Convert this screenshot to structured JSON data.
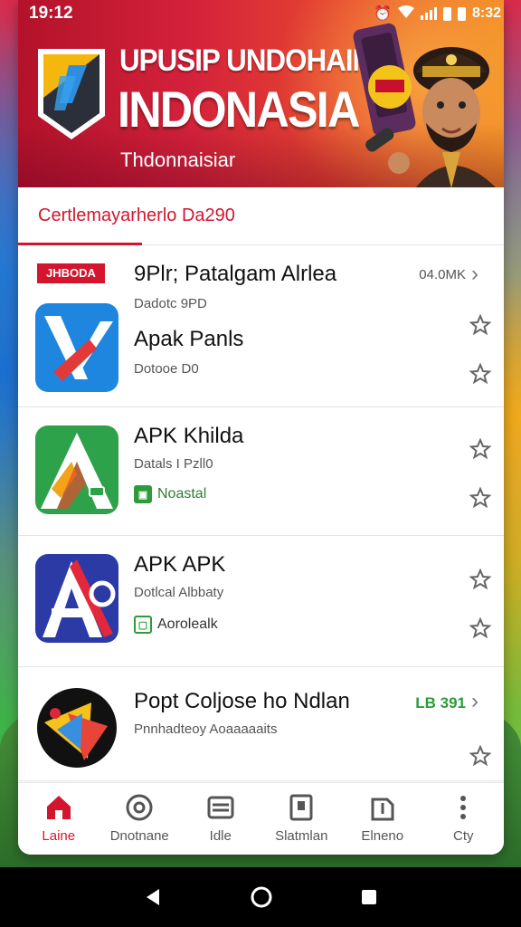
{
  "status_bar": {
    "time": "19:12",
    "clock_right": "8:32",
    "icons": [
      "alarm-icon",
      "wifi-icon",
      "signal-icon",
      "battery-icon"
    ]
  },
  "banner": {
    "title_line1": "UPUSIP UNDOHAIN",
    "title_line2": "INDONASIA",
    "subtitle": "Thdonnaisiar"
  },
  "section": {
    "title": "Certlemayarherlo Da290"
  },
  "apps": [
    {
      "tag": "JHBODA",
      "title": "9Plr; Patalgam Alrlea",
      "subtitle": "Dadotc 9PD",
      "size": "04.0MK",
      "name": "Apak Panls",
      "name_sub": "Dotooe D0"
    },
    {
      "title": "APK Khilda",
      "subtitle": "Datals I Pzll0",
      "badge": "Noastal"
    },
    {
      "title": "APK APK",
      "subtitle": "Dotlcal Albbaty",
      "badge": "Aorolealk"
    },
    {
      "title": "Popt Coljose ho Ndlan",
      "subtitle": "Pnnhadteoy Aoaaaaaits",
      "size": "LB 391"
    }
  ],
  "bottom_nav": [
    {
      "label": "Laine",
      "icon": "home-icon",
      "active": true
    },
    {
      "label": "Dnotnane",
      "icon": "search-circle-icon",
      "active": false
    },
    {
      "label": "Idle",
      "icon": "folder-icon",
      "active": false
    },
    {
      "label": "Slatmlan",
      "icon": "clipboard-icon",
      "active": false
    },
    {
      "label": "Elneno",
      "icon": "download-box-icon",
      "active": false
    },
    {
      "label": "Cty",
      "icon": "more-vert-icon",
      "active": false
    }
  ],
  "colors": {
    "accent": "#d3162e",
    "green": "#2e9b3a"
  }
}
